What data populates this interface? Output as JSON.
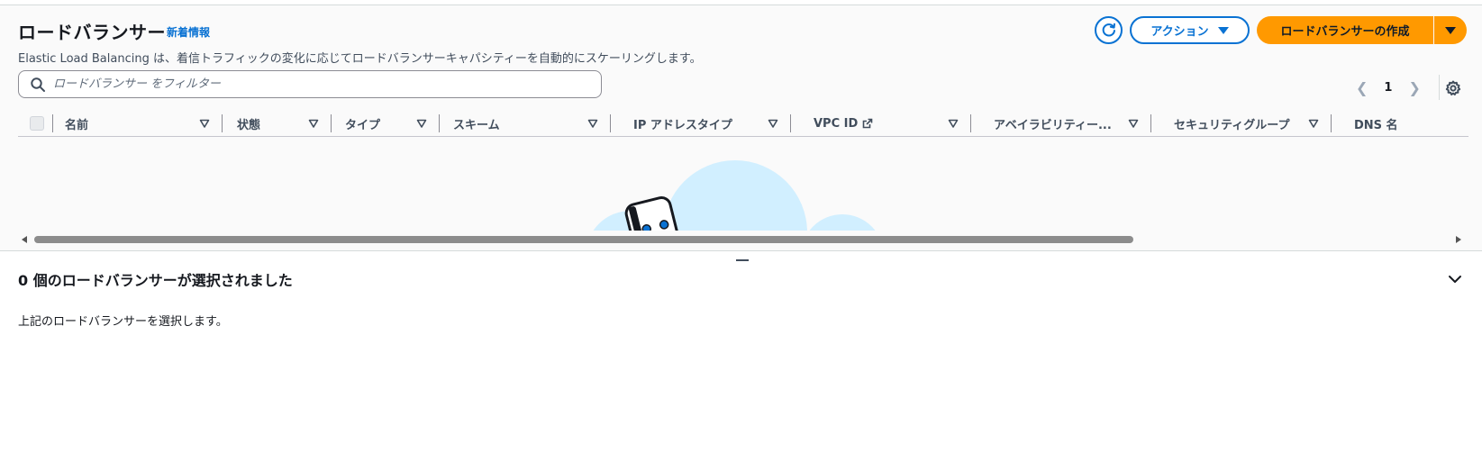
{
  "header": {
    "title": "ロードバランサー",
    "info_link": "新着情報",
    "description": "Elastic Load Balancing は、着信トラフィックの変化に応じてロードバランサーキャパシティーを自動的にスケーリングします。"
  },
  "toolbar": {
    "refresh_icon": "refresh-icon",
    "actions_label": "アクション",
    "create_label": "ロードバランサーの作成"
  },
  "filter": {
    "placeholder": "ロードバランサー をフィルター"
  },
  "pagination": {
    "current_page": "1"
  },
  "table": {
    "columns": [
      "名前",
      "状態",
      "タイプ",
      "スキーム",
      "IP アドレスタイプ",
      "VPC ID",
      "アベイラビリティー...",
      "セキュリティグループ",
      "DNS 名"
    ]
  },
  "details": {
    "title": "0 個のロードバランサーが選択されました",
    "description": "上記のロードバランサーを選択します。"
  },
  "colors": {
    "accent": "#0972d3",
    "primary_button": "#ff9900",
    "illustration": "#d1efff"
  }
}
